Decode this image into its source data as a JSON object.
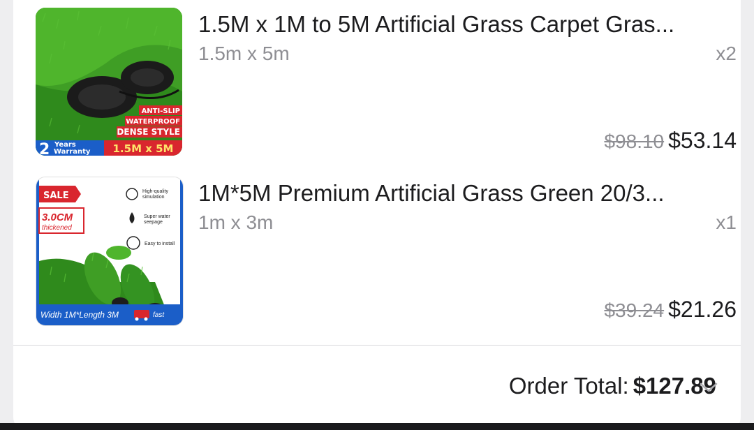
{
  "items": [
    {
      "title": "1.5M x 1M to 5M Artificial Grass Carpet Gras...",
      "variant": "1.5m x 5m",
      "quantity": "x2",
      "original_price": "$98.10",
      "price": "$53.14",
      "thumb": {
        "badges": [
          "ANTI-SLIP",
          "WATERPROOF",
          "DENSE STYLE"
        ],
        "warranty_num": "2",
        "warranty_top": "Years",
        "warranty_bottom": "Warranty",
        "size": "1.5M x 5M"
      }
    },
    {
      "title": "1M*5M Premium Artificial Grass Green 20/3...",
      "variant": "1m x 3m",
      "quantity": "x1",
      "original_price": "$39.24",
      "price": "$21.26",
      "thumb": {
        "sale": "SALE",
        "thickness": "3.0CM",
        "thickness_note": "thickened",
        "feature1a": "High-quality",
        "feature1b": "simulation",
        "feature2a": "Super water",
        "feature2b": "seepage",
        "feature3": "Easy to install",
        "dimensions": "Width 1M*Length 3M",
        "fast": "fast"
      }
    }
  ],
  "order_total": {
    "label": "Order Total:",
    "value": "$127.89"
  },
  "colors": {
    "grass": "#3a9a22",
    "sale_red": "#d9262e",
    "warranty_blue": "#1b5ec8",
    "muted": "#8e8e93"
  }
}
